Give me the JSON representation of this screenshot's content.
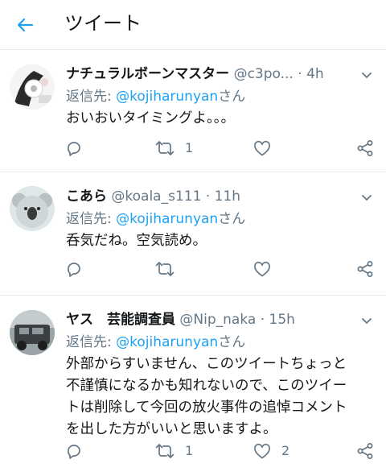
{
  "header": {
    "title": "ツイート"
  },
  "tweets": [
    {
      "name": "ナチュラルボーンマスター",
      "handle": "@c3po...",
      "dot": "·",
      "time": "4h",
      "reply_label": "返信先: ",
      "reply_user": "@kojiharunyan",
      "reply_suffix": "さん",
      "text": "おいおいタイミングよ。。。",
      "retweets": "1",
      "likes": ""
    },
    {
      "name": "こあら",
      "handle": "@koala_s111",
      "dot": "·",
      "time": "11h",
      "reply_label": "返信先: ",
      "reply_user": "@kojiharunyan",
      "reply_suffix": "さん",
      "text": "呑気だね。空気読め。",
      "retweets": "",
      "likes": ""
    },
    {
      "name": "ヤス　芸能調査員",
      "handle": "@Nip_naka",
      "dot": "·",
      "time": "15h",
      "reply_label": "返信先: ",
      "reply_user": "@kojiharunyan",
      "reply_suffix": "さん",
      "text_lines": [
        "外部からすいません、このツイートちょっと",
        "不謹慎になるかも知れないので、このツイー",
        "トは削除して今回の放火事件の追悼コメント",
        "を出した方がいいと思いますよ。"
      ],
      "retweets": "1",
      "likes": "2"
    }
  ],
  "icons": {
    "back": "arrow-left-icon",
    "caret": "chevron-down-icon",
    "reply": "reply-bubble-icon",
    "retweet": "retweet-icon",
    "like": "heart-icon",
    "share": "share-icon"
  },
  "colors": {
    "accent": "#1da1f2",
    "secondary_text": "#657786",
    "divider": "#e6ecf0"
  }
}
